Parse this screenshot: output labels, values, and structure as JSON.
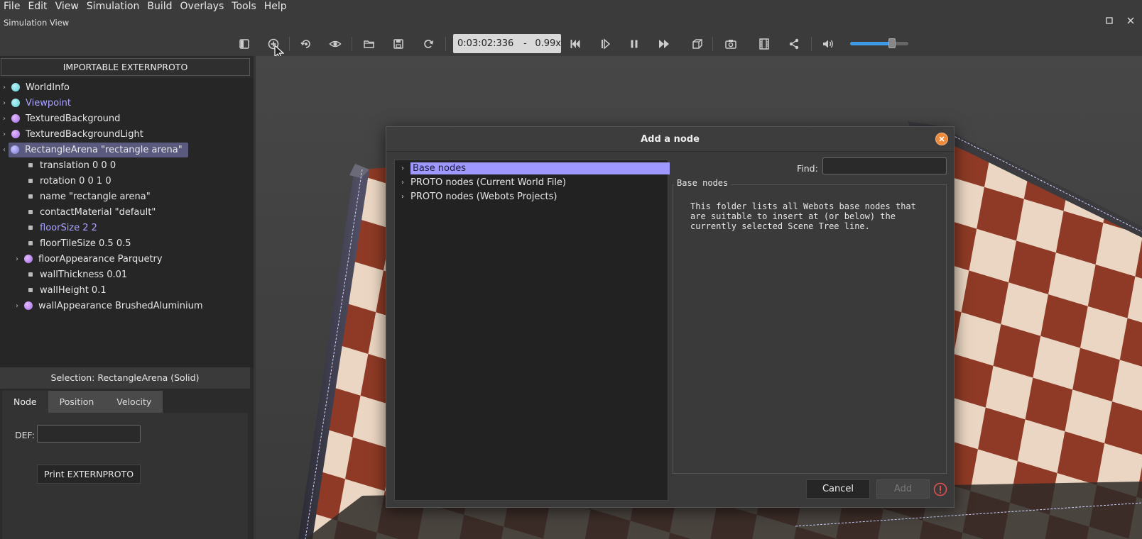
{
  "menu": {
    "items": [
      {
        "label": "File"
      },
      {
        "label": "Edit"
      },
      {
        "label": "View"
      },
      {
        "label": "Simulation"
      },
      {
        "label": "Build"
      },
      {
        "label": "Overlays"
      },
      {
        "label": "Tools"
      },
      {
        "label": "Help"
      }
    ]
  },
  "view": {
    "title": "Simulation View"
  },
  "toolbar": {
    "time": "0:03:02:336",
    "separator": "-",
    "speed": "0.99x",
    "volume_level": 0.72
  },
  "scene_tree": {
    "extern_button": "IMPORTABLE EXTERNPROTO",
    "nodes": [
      {
        "label": "WorldInfo"
      },
      {
        "label": "Viewpoint"
      },
      {
        "label": "TexturedBackground"
      },
      {
        "label": "TexturedBackgroundLight"
      },
      {
        "label": "RectangleArena \"rectangle arena\""
      }
    ],
    "fields": [
      {
        "label": "translation 0 0 0"
      },
      {
        "label": "rotation 0 0 1 0"
      },
      {
        "label": "name \"rectangle arena\""
      },
      {
        "label": "contactMaterial \"default\""
      },
      {
        "label": "floorSize 2 2"
      },
      {
        "label": "floorTileSize 0.5 0.5"
      },
      {
        "label": "floorAppearance Parquetry"
      },
      {
        "label": "wallThickness 0.01"
      },
      {
        "label": "wallHeight 0.1"
      },
      {
        "label": "wallAppearance BrushedAluminium"
      }
    ]
  },
  "selection": {
    "label": "Selection: RectangleArena (Solid)"
  },
  "tabs": [
    {
      "label": "Node"
    },
    {
      "label": "Position"
    },
    {
      "label": "Velocity"
    }
  ],
  "node_panel": {
    "def_label": "DEF:",
    "def_value": "",
    "print_button": "Print EXTERNPROTO"
  },
  "dialog": {
    "title": "Add a node",
    "categories": [
      {
        "label": "Base nodes"
      },
      {
        "label": "PROTO nodes (Current World File)"
      },
      {
        "label": "PROTO nodes (Webots Projects)"
      }
    ],
    "find_label": "Find:",
    "find_value": "",
    "info_title": "Base nodes",
    "info_text": "This folder lists all Webots base nodes that\nare suitable to insert at (or below) the\ncurrently selected Scene Tree line.",
    "cancel_label": "Cancel",
    "add_label": "Add"
  },
  "colors": {
    "selection": "#9e98ff",
    "accent": "#3d9be9",
    "close": "#ee8a3a",
    "warning": "#e05050"
  }
}
